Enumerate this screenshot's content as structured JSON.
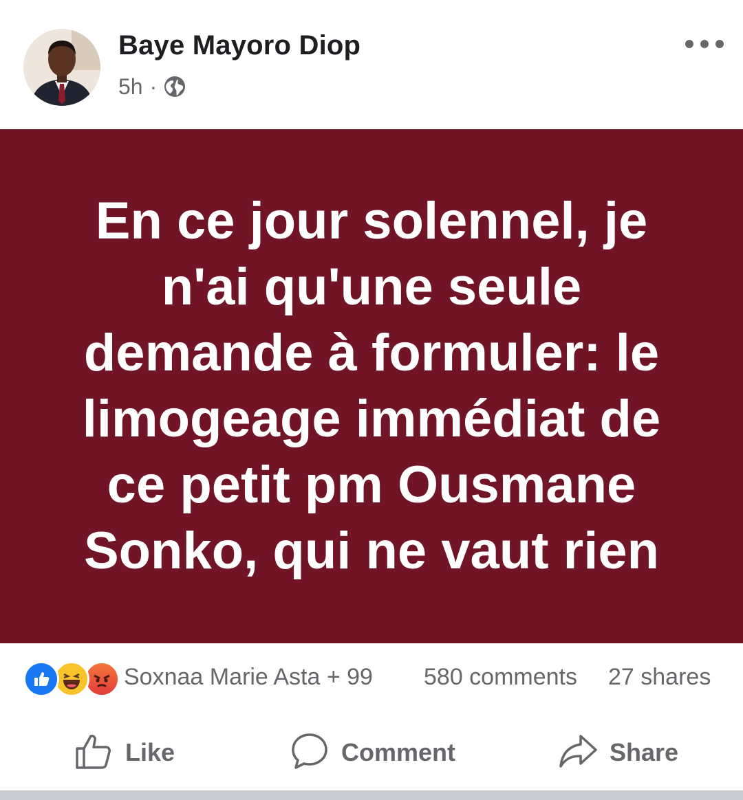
{
  "post": {
    "author": "Baye Mayoro Diop",
    "time": "5h",
    "separator": "·",
    "audience_icon": "globe-icon",
    "text": "En ce jour solennel, je n'ai qu'une seule demande à formuler: le limogeage immédiat de ce petit pm Ousmane Sonko, qui ne vaut rien",
    "background_color": "#701426",
    "text_color": "#ffffff"
  },
  "engagement": {
    "reaction_icons": [
      "like-icon",
      "haha-icon",
      "angry-icon"
    ],
    "reactors": "Soxnaa Marie Asta + 99",
    "comments": "580 comments",
    "shares": "27 shares"
  },
  "actions": {
    "like_label": "Like",
    "comment_label": "Comment",
    "share_label": "Share"
  },
  "colors": {
    "secondary_text": "#65676b",
    "like_blue": "#1877f2"
  }
}
